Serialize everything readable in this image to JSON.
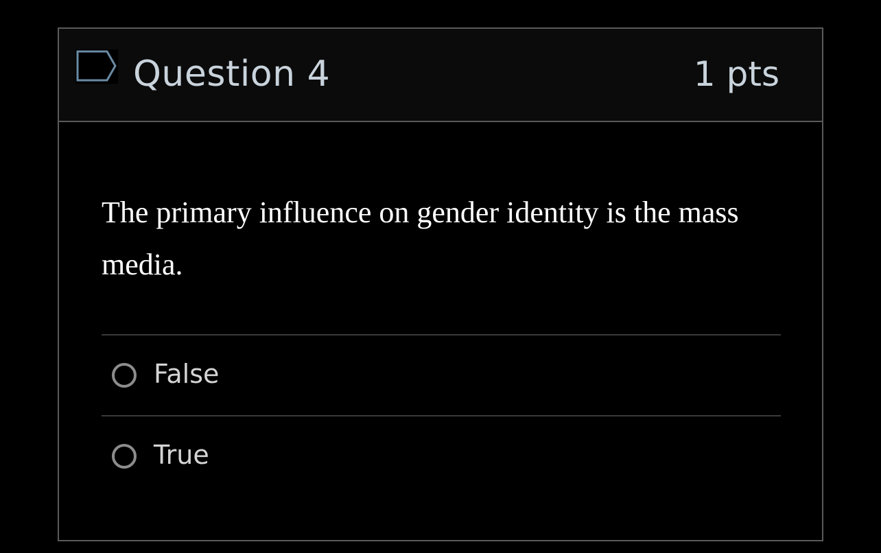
{
  "question": {
    "flag_icon": "flag-icon",
    "title": "Question 4",
    "points": "1 pts",
    "text": "The primary influence on gender identity is the mass media."
  },
  "answers": [
    {
      "label": "False",
      "selected": false
    },
    {
      "label": "True",
      "selected": false
    }
  ],
  "colors": {
    "background": "#000000",
    "header_background": "#0b0b0b",
    "border": "#5a5a5a",
    "header_text": "#c9d3dc",
    "flag_stroke": "#6a8ba5",
    "question_text": "#ffffff",
    "answer_text": "#d4d4d4",
    "radio_border": "#8c8c8c"
  }
}
